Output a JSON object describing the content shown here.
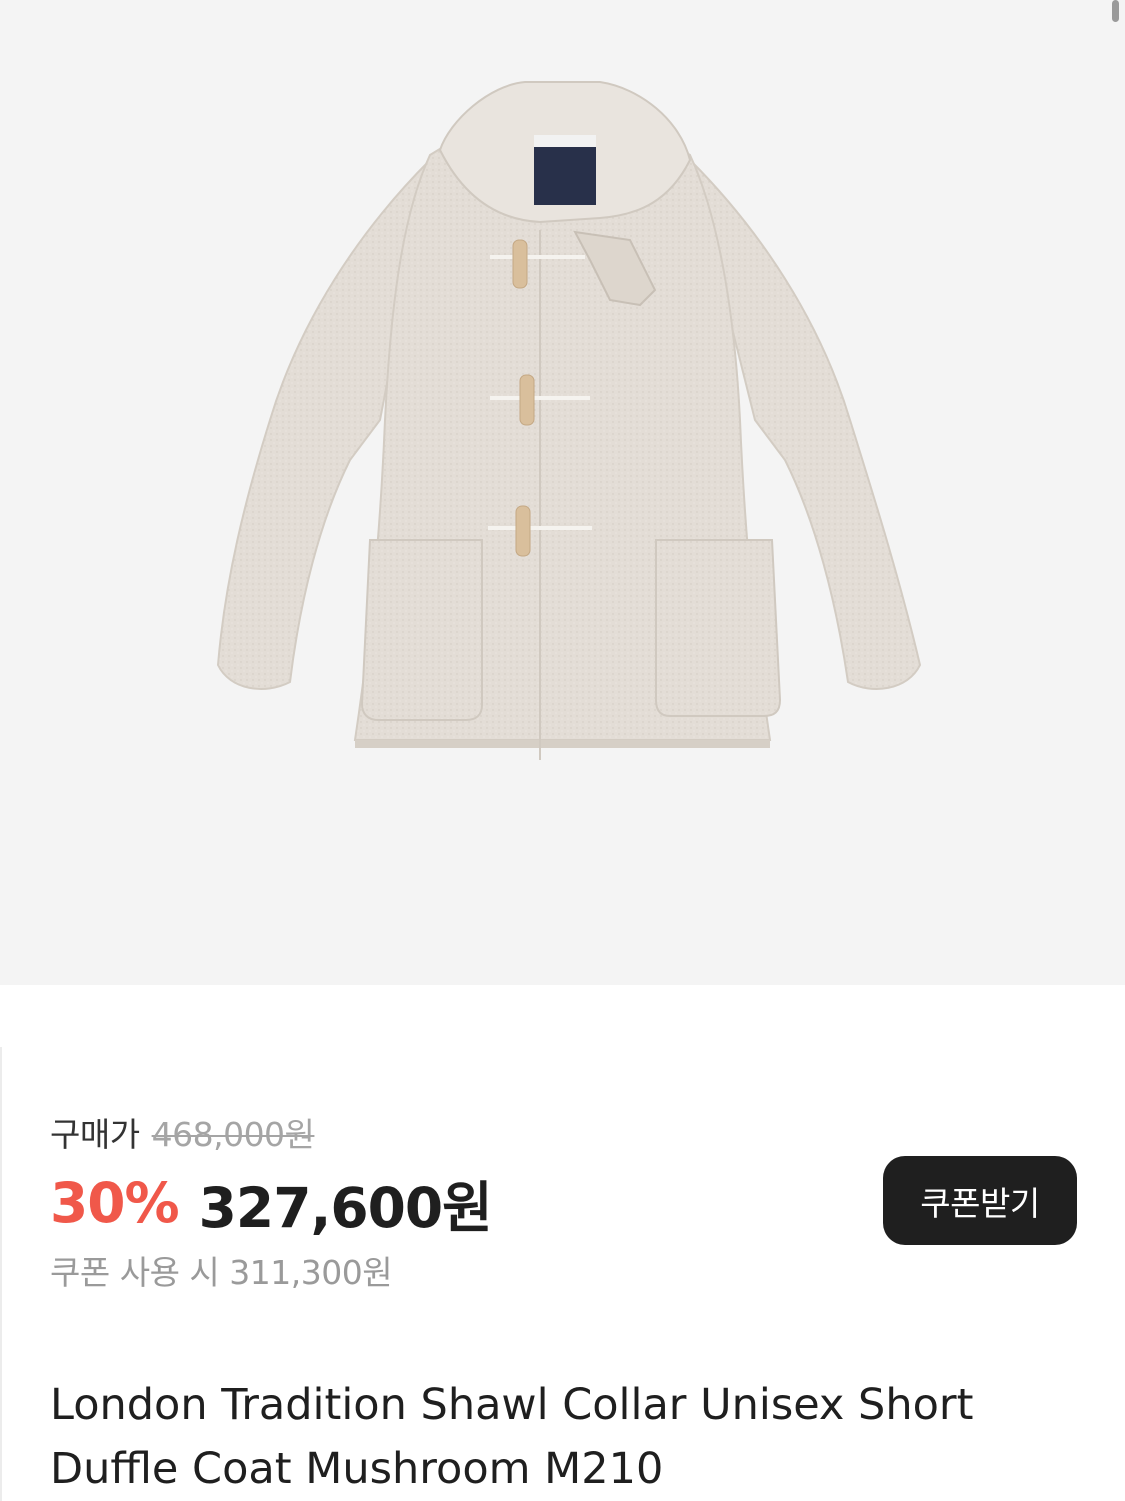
{
  "product": {
    "image_alt": "coat-image",
    "title": "London Tradition Shawl Collar Unisex Short Duffle Coat Mushroom M210"
  },
  "price": {
    "purchase_label": "구매가",
    "original_price": "468,000원",
    "discount_rate": "30%",
    "sale_price": "327,600원",
    "coupon_price_text": "쿠폰 사용 시 311,300원"
  },
  "coupon_button": {
    "label": "쿠폰받기"
  },
  "colors": {
    "discount": "#f0584a",
    "button_bg": "#1f1f1f",
    "image_bg": "#f4f4f4",
    "coat": "#e3ddd6"
  }
}
